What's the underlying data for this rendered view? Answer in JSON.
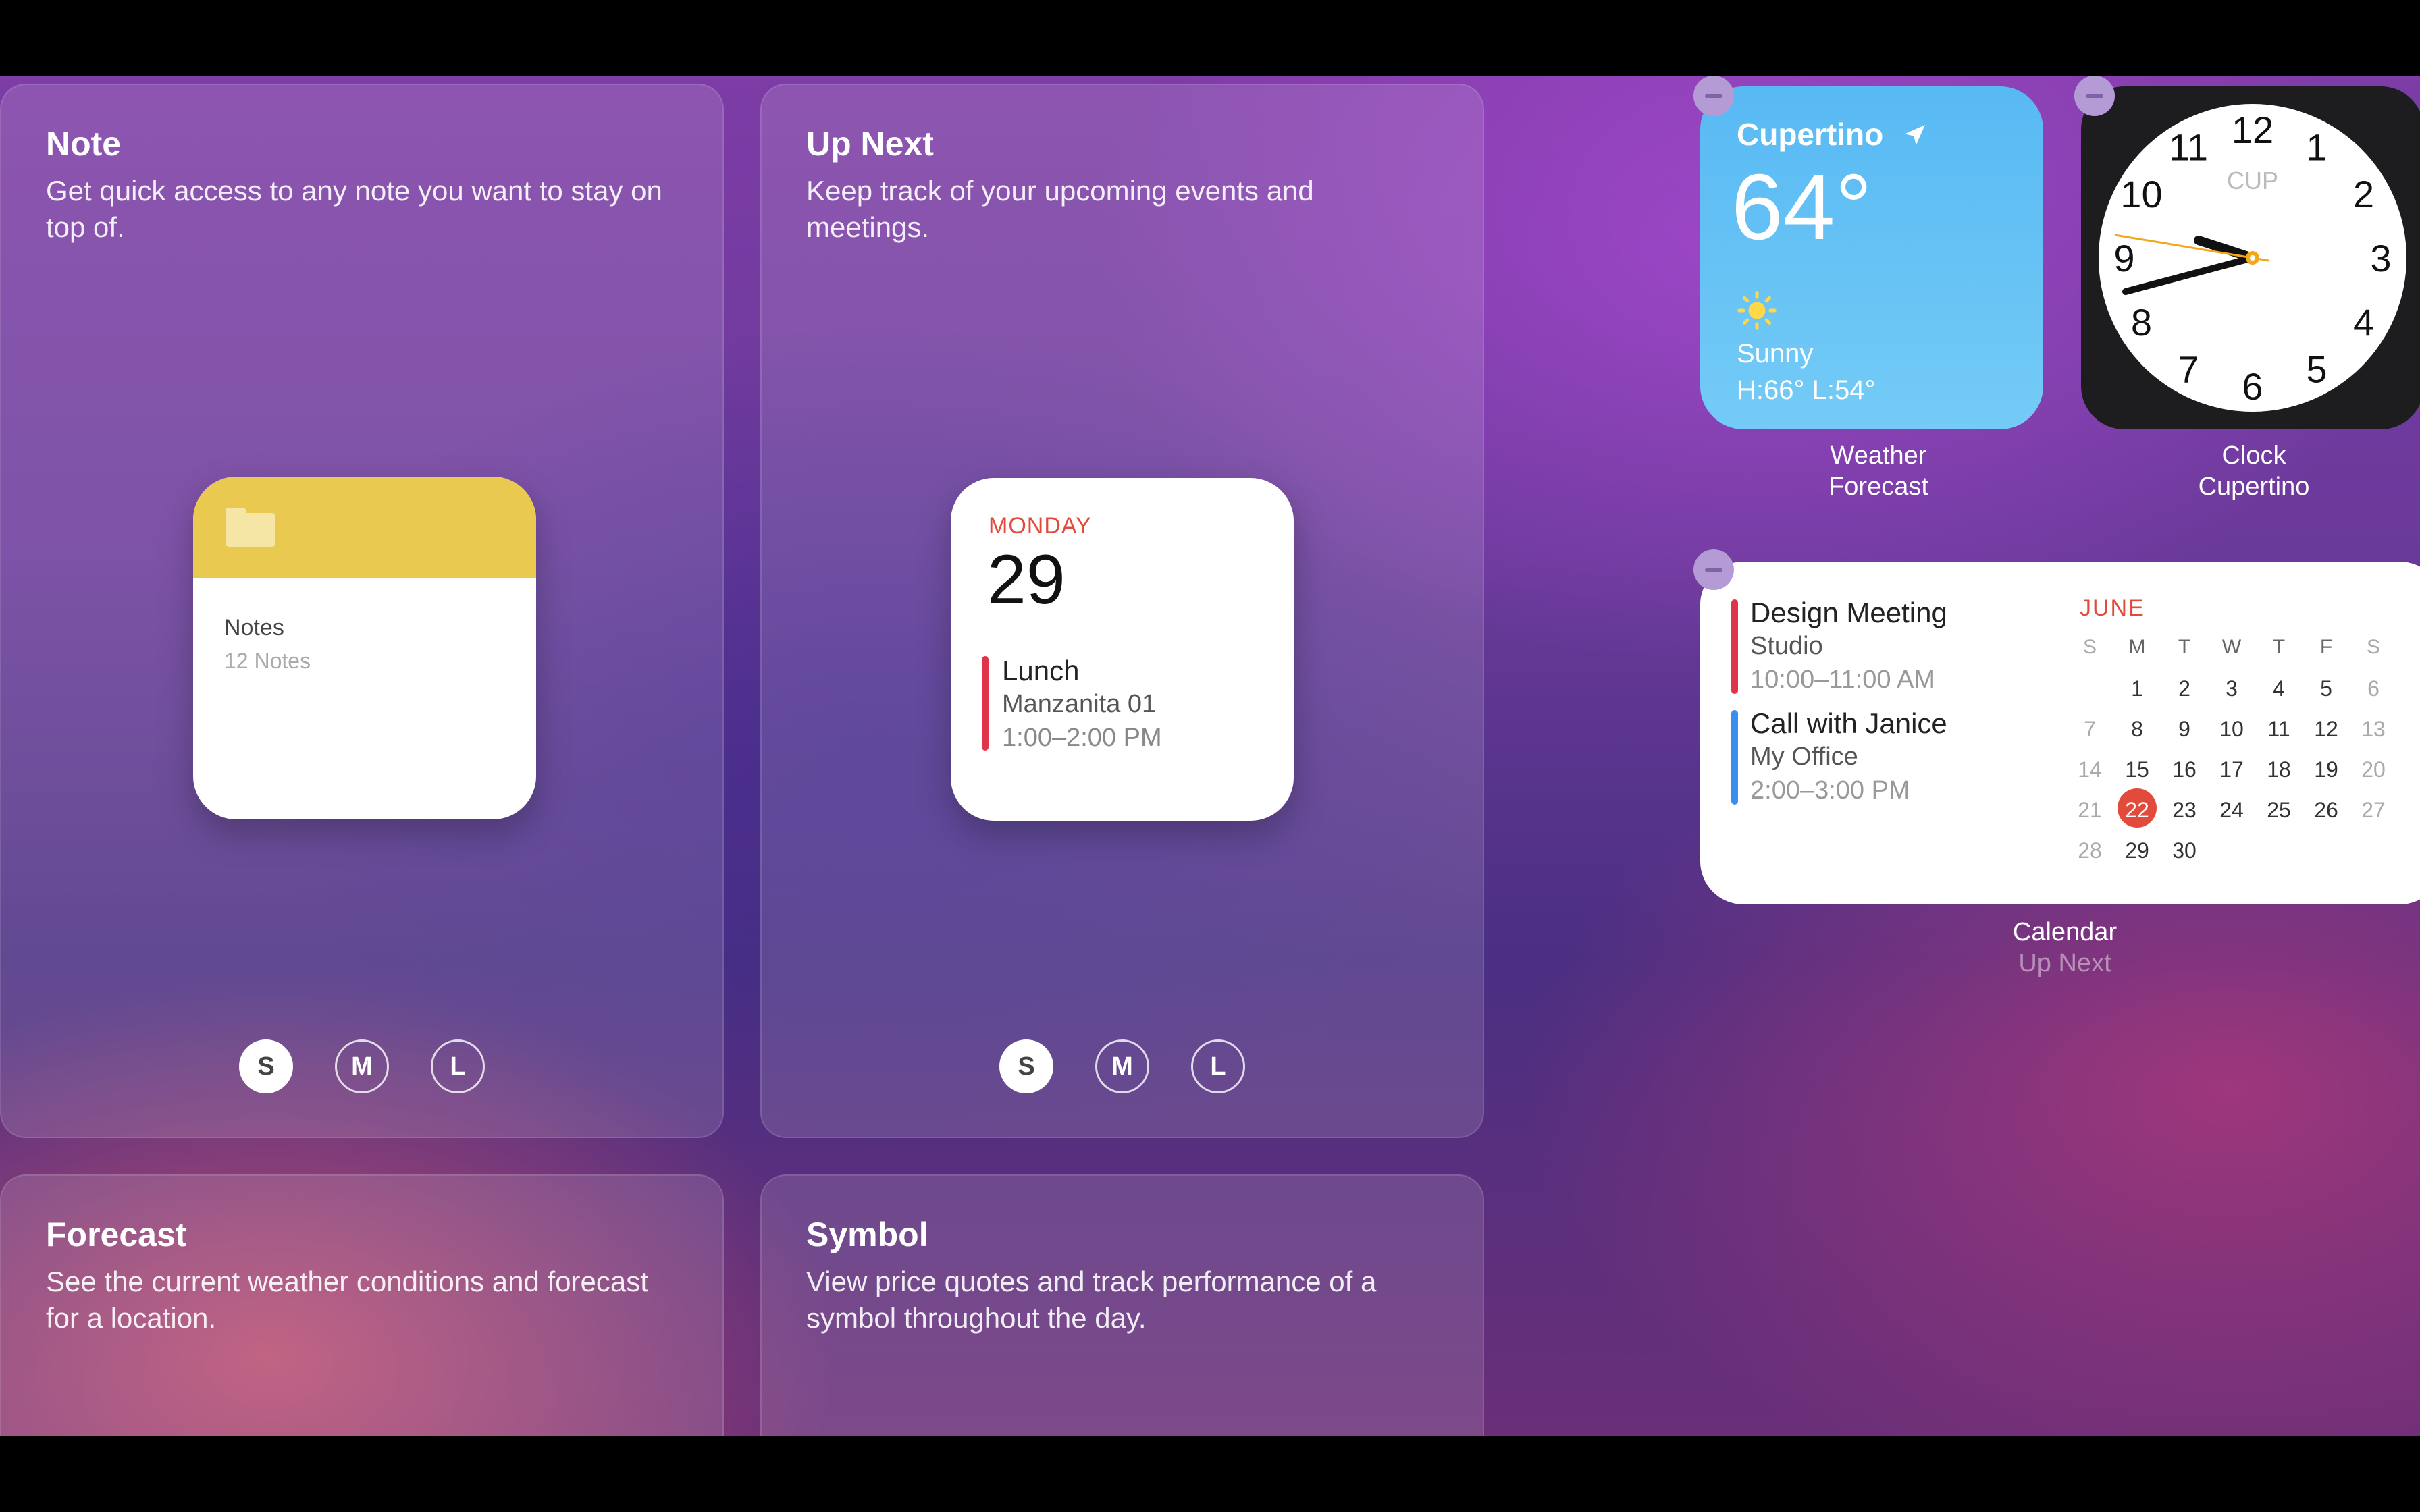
{
  "panels": {
    "note": {
      "title": "Note",
      "desc": "Get quick access to any note you want to stay on top of."
    },
    "upnext": {
      "title": "Up Next",
      "desc": "Keep track of your upcoming events and meetings."
    },
    "forecast": {
      "title": "Forecast",
      "desc": "See the current weather conditions and forecast for a location."
    },
    "symbol": {
      "title": "Symbol",
      "desc": "View price quotes and track performance of a symbol throughout the day."
    }
  },
  "sizes": [
    "S",
    "M",
    "L"
  ],
  "note_widget": {
    "name": "Notes",
    "count": "12 Notes"
  },
  "upnext_widget": {
    "day": "MONDAY",
    "date": "29",
    "event": "Lunch",
    "location": "Manzanita 01",
    "time": "1:00–2:00 PM"
  },
  "weather": {
    "city": "Cupertino",
    "temp": "64°",
    "condition": "Sunny",
    "hilo": "H:66°  L:54°",
    "label": "Weather",
    "sublabel": "Forecast"
  },
  "clock": {
    "city_code": "CUP",
    "numerals": [
      "12",
      "1",
      "2",
      "3",
      "4",
      "5",
      "6",
      "7",
      "8",
      "9",
      "10",
      "11"
    ],
    "label": "Clock",
    "sublabel": "Cupertino"
  },
  "calendar": {
    "events": [
      {
        "title": "Design Meeting",
        "location": "Studio",
        "time": "10:00–11:00 AM",
        "color": "#e0344a"
      },
      {
        "title": "Call with Janice",
        "location": "My Office",
        "time": "2:00–3:00 PM",
        "color": "#3a8ef0"
      }
    ],
    "month": "JUNE",
    "weekdays": [
      "S",
      "M",
      "T",
      "W",
      "T",
      "F",
      "S"
    ],
    "weeks": [
      [
        "",
        "1",
        "2",
        "3",
        "4",
        "5",
        "6"
      ],
      [
        "7",
        "8",
        "9",
        "10",
        "11",
        "12",
        "13"
      ],
      [
        "14",
        "15",
        "16",
        "17",
        "18",
        "19",
        "20"
      ],
      [
        "21",
        "22",
        "23",
        "24",
        "25",
        "26",
        "27"
      ],
      [
        "28",
        "29",
        "30",
        "",
        "",
        "",
        ""
      ]
    ],
    "today": "22",
    "label": "Calendar",
    "sublabel": "Up Next"
  }
}
